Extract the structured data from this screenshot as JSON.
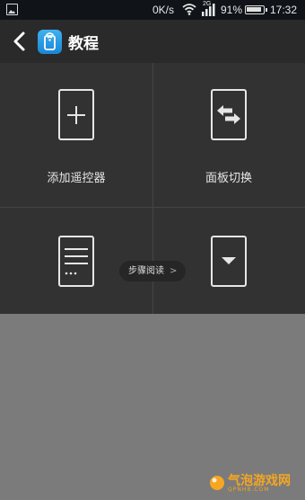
{
  "status_bar": {
    "speed": "0K/s",
    "network_type": "2G",
    "battery_percent": "91%",
    "time": "17:32"
  },
  "header": {
    "title": "教程"
  },
  "tiles": [
    {
      "label": "添加遥控器",
      "icon": "plus-icon"
    },
    {
      "label": "面板切换",
      "icon": "swap-arrows-icon"
    },
    {
      "label": "",
      "icon": "list-menu-icon"
    },
    {
      "label": "",
      "icon": "dropdown-arrow-icon"
    }
  ],
  "step_pill": {
    "label": "步骤阅读",
    "chevron": ">"
  },
  "watermark": {
    "name": "气泡游戏网",
    "url": "QPNHB.COM"
  },
  "colors": {
    "accent_app_icon": "#2a9be6",
    "watermark": "#f5a623"
  }
}
